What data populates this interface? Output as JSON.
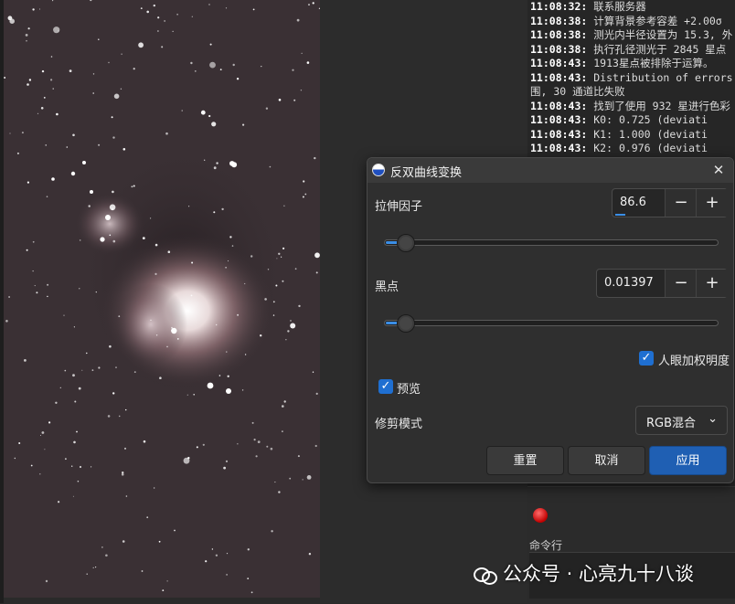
{
  "log": {
    "lines": [
      {
        "time": "11:08:32:",
        "text": "联系服务器"
      },
      {
        "time": "11:08:38:",
        "text": "计算背景参考容差 +2.00σ"
      },
      {
        "time": "11:08:38:",
        "text": "测光内半径设置为 15.3, 外"
      },
      {
        "time": "11:08:38:",
        "text": "执行孔径测光于 2845 星点"
      },
      {
        "time": "11:08:43:",
        "text": "1913星点被排除于运算。"
      },
      {
        "time": "11:08:43:",
        "text": "Distribution of errors"
      },
      {
        "time": "",
        "text": "围, 30 通道比失败"
      },
      {
        "time": "11:08:43:",
        "text": "找到了使用 932 星进行色彩"
      },
      {
        "time": "11:08:43:",
        "text": "K0: 0.725      (deviati"
      },
      {
        "time": "11:08:43:",
        "text": "K1: 1.000      (deviati"
      },
      {
        "time": "11:08:43:",
        "text": "K2: 0.976      (deviati"
      }
    ]
  },
  "dialog": {
    "title": "反双曲线变换",
    "close_glyph": "✕",
    "stretch": {
      "label": "拉伸因子",
      "value": "86.6",
      "slider_level": 0.04
    },
    "black_point": {
      "label": "黑点",
      "value": "0.01397",
      "slider_level": 0.04
    },
    "minus_glyph": "−",
    "plus_glyph": "+",
    "eye_weighted": {
      "label": "人眼加权明度",
      "checked": true
    },
    "preview": {
      "label": "预览",
      "checked": true
    },
    "clip_mode": {
      "label": "修剪模式",
      "selected": "RGB混合"
    },
    "buttons": {
      "reset": "重置",
      "cancel": "取消",
      "apply": "应用"
    }
  },
  "console": {
    "label": "命令行"
  },
  "watermark": {
    "text": "公众号 · 心亮九十八谈"
  },
  "colors": {
    "accent": "#1f5fb3",
    "checkbox": "#1f6fd1",
    "record": "#d00000"
  }
}
